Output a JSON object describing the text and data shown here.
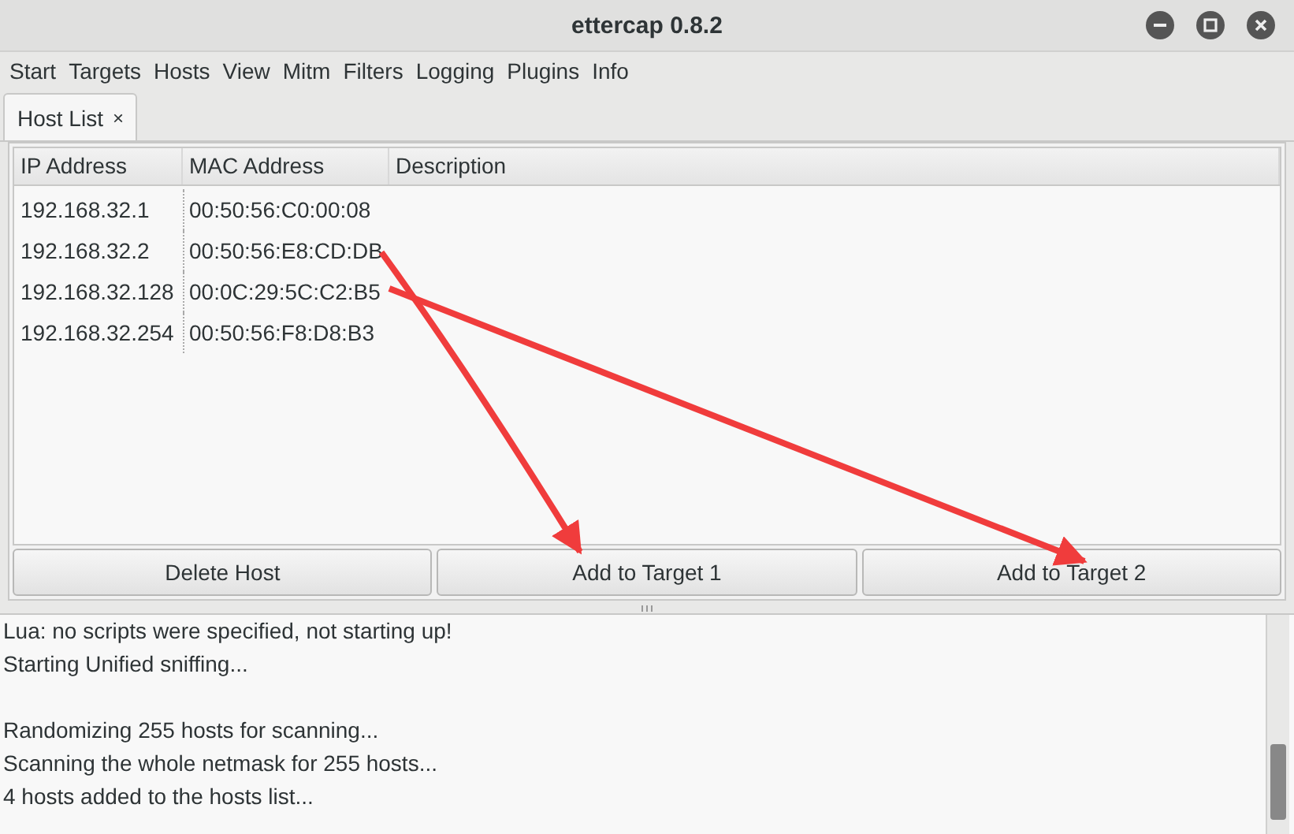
{
  "window": {
    "title": "ettercap 0.8.2"
  },
  "menu": [
    "Start",
    "Targets",
    "Hosts",
    "View",
    "Mitm",
    "Filters",
    "Logging",
    "Plugins",
    "Info"
  ],
  "tabs": [
    {
      "label": "Host List",
      "close": "×",
      "selected": true
    }
  ],
  "table": {
    "columns": [
      "IP Address",
      "MAC Address",
      "Description"
    ],
    "rows": [
      [
        "192.168.32.1",
        "00:50:56:C0:00:08"
      ],
      [
        "192.168.32.2",
        "00:50:56:E8:CD:DB"
      ],
      [
        "192.168.32.128",
        "00:0C:29:5C:C2:B5"
      ],
      [
        "192.168.32.254",
        "00:50:56:F8:D8:B3"
      ]
    ]
  },
  "buttons": [
    "Delete Host",
    "Add to Target 1",
    "Add to Target 2"
  ],
  "log_blocks": [
    [
      "Lua: no scripts were specified, not starting up!",
      "Starting Unified sniffing..."
    ],
    [
      "Randomizing 255 hosts for scanning...",
      "Scanning the whole netmask for 255 hosts...",
      "4 hosts added to the hosts list..."
    ]
  ]
}
